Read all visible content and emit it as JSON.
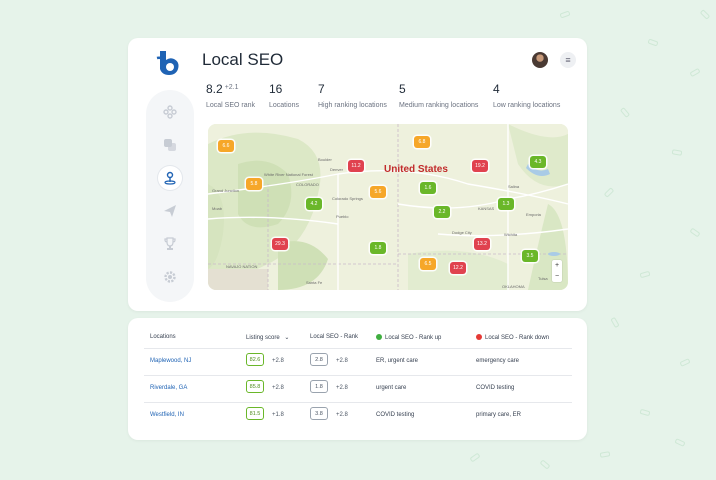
{
  "app": {
    "title": "Local SEO"
  },
  "stats": [
    {
      "value": "8.2",
      "delta": "+2.1",
      "label": "Local SEO rank"
    },
    {
      "value": "16",
      "label": "Locations"
    },
    {
      "value": "7",
      "label": "High ranking locations"
    },
    {
      "value": "5",
      "label": "Medium ranking locations"
    },
    {
      "value": "4",
      "label": "Low ranking locations"
    }
  ],
  "sidebar": {
    "icons": [
      "apps-icon",
      "copy-icon",
      "location-pin-icon",
      "send-icon",
      "trophy-icon",
      "gear-icon"
    ],
    "active": "location-pin-icon"
  },
  "map": {
    "country": "United States",
    "places": {
      "boulder": "Boulder",
      "denver": "Denver",
      "colorado": "COLORADO",
      "colorado_springs": "Colorado Springs",
      "pueblo": "Pueblo",
      "white_river": "White River National Forest",
      "grand_junction": "Grand Junction",
      "kansas": "KANSAS",
      "wichita": "Wichita",
      "dodge_city": "Dodge City",
      "salina": "Salina",
      "oklahoma": "OKLAHOMA",
      "tulsa": "Tulsa",
      "moab": "Moab",
      "navajo": "NAVAJO NATION",
      "santa_fe": "Santa Fe",
      "emporia": "Emporia",
      "alamosa": "Alamosa"
    },
    "pins": [
      {
        "value": "6.6",
        "color": "orange"
      },
      {
        "value": "6.8",
        "color": "orange"
      },
      {
        "value": "11.2",
        "color": "red"
      },
      {
        "value": "19.2",
        "color": "red"
      },
      {
        "value": "4.3",
        "color": "green"
      },
      {
        "value": "5.8",
        "color": "orange"
      },
      {
        "value": "5.6",
        "color": "orange"
      },
      {
        "value": "1.6",
        "color": "green"
      },
      {
        "value": "4.2",
        "color": "green"
      },
      {
        "value": "2.2",
        "color": "green"
      },
      {
        "value": "1.3",
        "color": "green"
      },
      {
        "value": "29.3",
        "color": "red"
      },
      {
        "value": "1.8",
        "color": "green"
      },
      {
        "value": "13.2",
        "color": "red"
      },
      {
        "value": "3.5",
        "color": "green"
      },
      {
        "value": "6.5",
        "color": "orange"
      },
      {
        "value": "12.2",
        "color": "red"
      }
    ],
    "zoom_in": "+",
    "zoom_out": "−"
  },
  "table": {
    "headers": {
      "locations": "Locations",
      "listing_score": "Listing score",
      "sort_arrow": "⌄",
      "seo_rank": "Local SEO - Rank",
      "rank_up": "Local SEO - Rank up",
      "rank_down": "Local SEO - Rank down"
    },
    "rank_up_color": "#3fae3f",
    "rank_down_color": "#e53935",
    "rows": [
      {
        "location": "Maplewood, NJ",
        "score": "82.6",
        "score_delta": "+2.8",
        "rank": "2.8",
        "rank_delta": "+2.8",
        "up": "ER, urgent care",
        "down": "emergency care"
      },
      {
        "location": "Riverdale, GA",
        "score": "85.8",
        "score_delta": "+2.8",
        "rank": "1.8",
        "rank_delta": "+2.8",
        "up": "urgent care",
        "down": "COVID testing"
      },
      {
        "location": "Westfield, IN",
        "score": "81.5",
        "score_delta": "+1.8",
        "rank": "3.8",
        "rank_delta": "+2.8",
        "up": "COVID testing",
        "down": "primary care, ER"
      }
    ]
  }
}
